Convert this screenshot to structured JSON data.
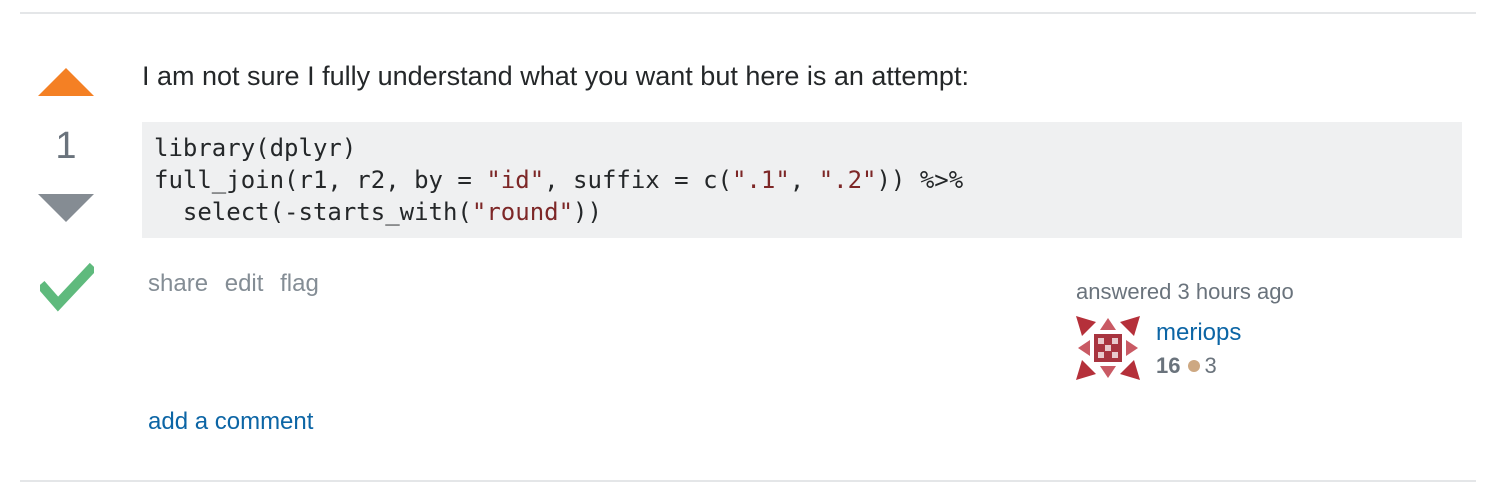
{
  "votes": {
    "count": "1"
  },
  "colors": {
    "upvote": "#f48024",
    "downvote": "#858c93",
    "accepted": "#5fba7d",
    "link": "#0c65a5",
    "badge_bronze": "#cda882"
  },
  "icons": {
    "up": "upvote-triangle-icon",
    "down": "downvote-triangle-icon",
    "accepted": "checkmark-icon"
  },
  "post": {
    "text": "I am not sure I fully understand what you want but here is an attempt:",
    "code": {
      "line1": "library(dplyr)",
      "line2_a": "full_join(r1, r2, by = ",
      "line2_s1": "\"id\"",
      "line2_b": ", suffix = c(",
      "line2_s2": "\".1\"",
      "line2_c": ", ",
      "line2_s3": "\".2\"",
      "line2_d": ")) %>%",
      "line3_a": "  select(-starts_with(",
      "line3_s1": "\"round\"",
      "line3_b": "))"
    }
  },
  "menu": {
    "share": "share",
    "edit": "edit",
    "flag": "flag"
  },
  "user": {
    "action_time": "answered 3 hours ago",
    "name": "meriops",
    "reputation": "16",
    "bronze_count": "3"
  },
  "comments": {
    "add_label": "add a comment"
  }
}
